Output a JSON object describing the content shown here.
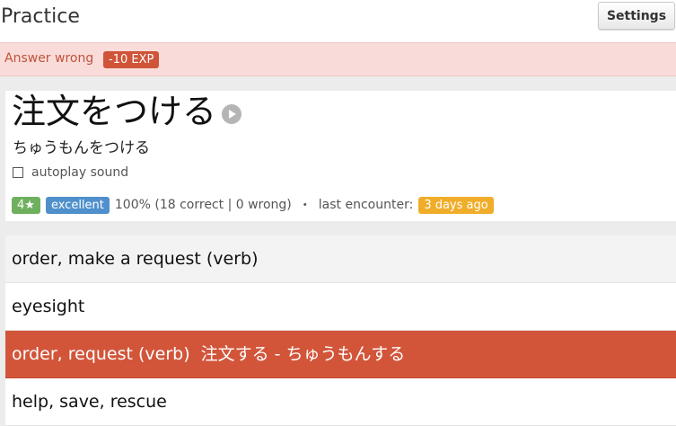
{
  "header": {
    "title": "Practice",
    "settings_label": "Settings"
  },
  "alert": {
    "message": "Answer wrong",
    "exp": "-10 EXP"
  },
  "word": {
    "kanji": "注文をつける",
    "reading": "ちゅうもんをつける",
    "autoplay_label": "autoplay sound",
    "autoplay_checked": false
  },
  "stats": {
    "stars": "4★",
    "level": "excellent",
    "summary": "100% (18 correct | 0 wrong)",
    "separator": "・",
    "last_label": "last encounter:",
    "last_value": "3 days ago"
  },
  "options": [
    {
      "text": "order, make a request (verb)"
    },
    {
      "text": "eyesight"
    },
    {
      "text": "order, request (verb)",
      "extra": "注文する - ちゅうもんする"
    },
    {
      "text": "help, save, rescue"
    }
  ],
  "colors": {
    "wrong": "#d2553a",
    "alert_bg": "#f9dcd9",
    "stars_badge": "#6fb05f",
    "level_badge": "#4f8fcc",
    "days_badge": "#f0ad2a"
  }
}
